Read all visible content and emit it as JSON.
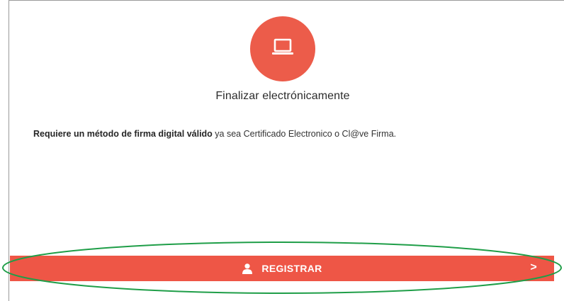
{
  "option": {
    "icon": "laptop-icon",
    "title": "Finalizar electrónicamente",
    "description_bold": "Requiere un método de firma digital válido",
    "description_rest": " ya sea Certificado Electronico o Cl@ve Firma."
  },
  "action": {
    "label": "REGISTRAR",
    "icon": "user-icon",
    "chevron": ">"
  },
  "colors": {
    "accent": "#ee5646",
    "highlight": "#1f9e48"
  }
}
